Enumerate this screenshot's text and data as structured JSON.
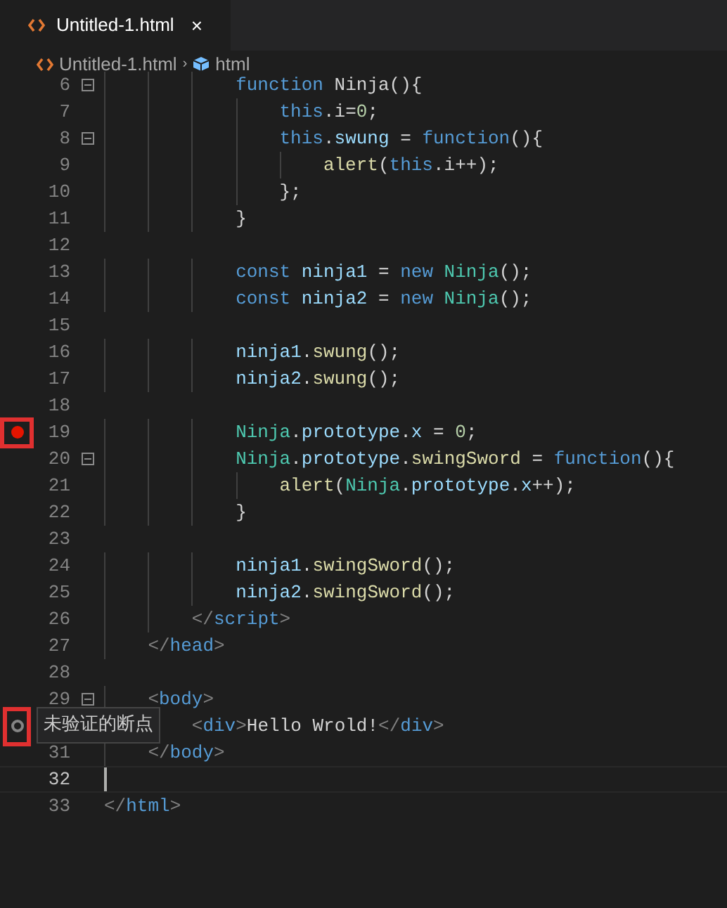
{
  "tabs": [
    {
      "label": "Untitled-1.html",
      "close": "×",
      "selected": true
    }
  ],
  "breadcrumb": {
    "file": "Untitled-1.html",
    "separator": "›",
    "symbol": "html"
  },
  "lines": [
    {
      "n": "6",
      "fold": true,
      "tokens": [
        {
          "kind": "kw",
          "t": "            function"
        },
        {
          "kind": "p",
          "t": " Ninja(){"
        }
      ]
    },
    {
      "n": "7",
      "tokens": [
        {
          "kind": "kw",
          "t": "                this"
        },
        {
          "kind": "p",
          "t": ".i="
        },
        {
          "kind": "num",
          "t": "0"
        },
        {
          "kind": "p",
          "t": ";"
        }
      ]
    },
    {
      "n": "8",
      "fold": true,
      "tokens": [
        {
          "kind": "kw",
          "t": "                this"
        },
        {
          "kind": "p",
          "t": "."
        },
        {
          "kind": "var",
          "t": "swung"
        },
        {
          "kind": "p",
          "t": " = "
        },
        {
          "kind": "kw",
          "t": "function"
        },
        {
          "kind": "p",
          "t": "(){"
        }
      ]
    },
    {
      "n": "9",
      "tokens": [
        {
          "kind": "fn",
          "t": "                    alert"
        },
        {
          "kind": "p",
          "t": "("
        },
        {
          "kind": "kw",
          "t": "this"
        },
        {
          "kind": "p",
          "t": ".i++);"
        }
      ]
    },
    {
      "n": "10",
      "tokens": [
        {
          "kind": "p",
          "t": "                };"
        }
      ]
    },
    {
      "n": "11",
      "tokens": [
        {
          "kind": "p",
          "t": "            }"
        }
      ]
    },
    {
      "n": "12"
    },
    {
      "n": "13",
      "tokens": [
        {
          "kind": "kw",
          "t": "            const"
        },
        {
          "kind": "var",
          "t": " ninja1"
        },
        {
          "kind": "p",
          "t": " = "
        },
        {
          "kind": "kw",
          "t": "new"
        },
        {
          "kind": "type",
          "t": " Ninja"
        },
        {
          "kind": "p",
          "t": "();"
        }
      ]
    },
    {
      "n": "14",
      "tokens": [
        {
          "kind": "kw",
          "t": "            const"
        },
        {
          "kind": "var",
          "t": " ninja2"
        },
        {
          "kind": "p",
          "t": " = "
        },
        {
          "kind": "kw",
          "t": "new"
        },
        {
          "kind": "type",
          "t": " Ninja"
        },
        {
          "kind": "p",
          "t": "();"
        }
      ]
    },
    {
      "n": "15"
    },
    {
      "n": "16",
      "tokens": [
        {
          "kind": "var",
          "t": "            ninja1"
        },
        {
          "kind": "p",
          "t": "."
        },
        {
          "kind": "fn",
          "t": "swung"
        },
        {
          "kind": "p",
          "t": "();"
        }
      ]
    },
    {
      "n": "17",
      "tokens": [
        {
          "kind": "var",
          "t": "            ninja2"
        },
        {
          "kind": "p",
          "t": "."
        },
        {
          "kind": "fn",
          "t": "swung"
        },
        {
          "kind": "p",
          "t": "();"
        }
      ]
    },
    {
      "n": "18"
    },
    {
      "n": "19",
      "breakpoint": true,
      "verified": true,
      "tokens": [
        {
          "kind": "type",
          "t": "            Ninja"
        },
        {
          "kind": "p",
          "t": "."
        },
        {
          "kind": "var",
          "t": "prototype"
        },
        {
          "kind": "p",
          "t": "."
        },
        {
          "kind": "var",
          "t": "x"
        },
        {
          "kind": "p",
          "t": " = "
        },
        {
          "kind": "num",
          "t": "0"
        },
        {
          "kind": "p",
          "t": ";"
        }
      ]
    },
    {
      "n": "20",
      "fold": true,
      "tokens": [
        {
          "kind": "type",
          "t": "            Ninja"
        },
        {
          "kind": "p",
          "t": "."
        },
        {
          "kind": "var",
          "t": "prototype"
        },
        {
          "kind": "p",
          "t": "."
        },
        {
          "kind": "fn",
          "t": "swingSword"
        },
        {
          "kind": "p",
          "t": " = "
        },
        {
          "kind": "kw",
          "t": "function"
        },
        {
          "kind": "p",
          "t": "(){"
        }
      ]
    },
    {
      "n": "21",
      "tokens": [
        {
          "kind": "fn",
          "t": "                alert"
        },
        {
          "kind": "p",
          "t": "("
        },
        {
          "kind": "type",
          "t": "Ninja"
        },
        {
          "kind": "p",
          "t": "."
        },
        {
          "kind": "var",
          "t": "prototype"
        },
        {
          "kind": "p",
          "t": "."
        },
        {
          "kind": "var",
          "t": "x"
        },
        {
          "kind": "p",
          "t": "++);"
        }
      ]
    },
    {
      "n": "22",
      "tokens": [
        {
          "kind": "p",
          "t": "            }"
        }
      ]
    },
    {
      "n": "23"
    },
    {
      "n": "24",
      "tokens": [
        {
          "kind": "var",
          "t": "            ninja1"
        },
        {
          "kind": "p",
          "t": "."
        },
        {
          "kind": "fn",
          "t": "swingSword"
        },
        {
          "kind": "p",
          "t": "();"
        }
      ]
    },
    {
      "n": "25",
      "tokens": [
        {
          "kind": "var",
          "t": "            ninja2"
        },
        {
          "kind": "p",
          "t": "."
        },
        {
          "kind": "fn",
          "t": "swingSword"
        },
        {
          "kind": "p",
          "t": "();"
        }
      ]
    },
    {
      "n": "26",
      "tokens": [
        {
          "kind": "punc",
          "t": "        </"
        },
        {
          "kind": "tag",
          "t": "script"
        },
        {
          "kind": "punc",
          "t": ">"
        }
      ]
    },
    {
      "n": "27",
      "tokens": [
        {
          "kind": "punc",
          "t": "    </"
        },
        {
          "kind": "tag",
          "t": "head"
        },
        {
          "kind": "punc",
          "t": ">"
        }
      ]
    },
    {
      "n": "28"
    },
    {
      "n": "29",
      "fold": true,
      "tokens": [
        {
          "kind": "punc",
          "t": "    <"
        },
        {
          "kind": "tag",
          "t": "body"
        },
        {
          "kind": "punc",
          "t": ">"
        }
      ]
    },
    {
      "breakpoint": true,
      "verified": false,
      "tooltip": "未验证的断点",
      "tokens": [
        {
          "kind": "punc",
          "t": "        <"
        },
        {
          "kind": "tag",
          "t": "div"
        },
        {
          "kind": "punc",
          "t": ">"
        },
        {
          "kind": "p",
          "t": "Hello Wrold!"
        },
        {
          "kind": "punc",
          "t": "</"
        },
        {
          "kind": "tag",
          "t": "div"
        },
        {
          "kind": "punc",
          "t": ">"
        }
      ]
    },
    {
      "n": "31",
      "tokens": [
        {
          "kind": "punc",
          "t": "    </"
        },
        {
          "kind": "tag",
          "t": "body"
        },
        {
          "kind": "punc",
          "t": ">"
        }
      ]
    },
    {
      "n": "32",
      "current": true
    },
    {
      "n": "33",
      "tokens": [
        {
          "kind": "punc",
          "t": "</"
        },
        {
          "kind": "tag",
          "t": "html"
        },
        {
          "kind": "punc",
          "t": ">"
        }
      ]
    }
  ]
}
